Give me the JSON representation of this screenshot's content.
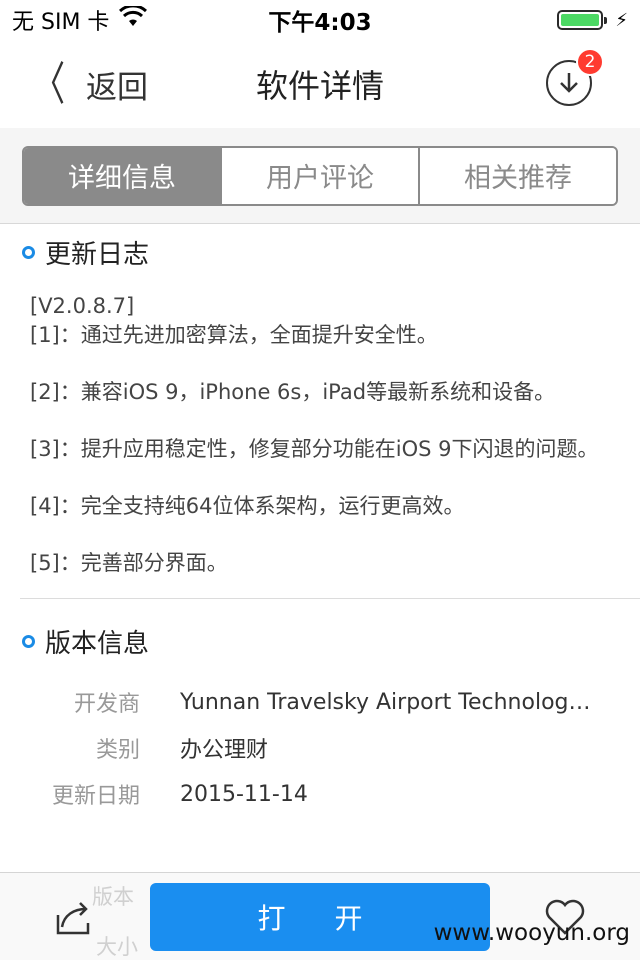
{
  "statusbar": {
    "carrier": "无 SIM 卡",
    "time": "下午4:03"
  },
  "navbar": {
    "back_label": "返回",
    "title": "软件详情",
    "download_badge": "2"
  },
  "tabs": [
    {
      "label": "详细信息",
      "active": true
    },
    {
      "label": "用户评论",
      "active": false
    },
    {
      "label": "相关推荐",
      "active": false
    }
  ],
  "changelog": {
    "title": "更新日志",
    "version": "[V2.0.8.7]",
    "items": [
      "[1]：通过先进加密算法，全面提升安全性。",
      "[2]：兼容iOS 9，iPhone 6s，iPad等最新系统和设备。",
      "[3]：提升应用稳定性，修复部分功能在iOS 9下闪退的问题。",
      "[4]：完全支持纯64位体系架构，运行更高效。",
      "[5]：完善部分界面。"
    ]
  },
  "version_info": {
    "title": "版本信息",
    "rows": [
      {
        "key": "开发商",
        "value": "Yunnan Travelsky Airport Technology C..."
      },
      {
        "key": "类别",
        "value": "办公理财"
      },
      {
        "key": "更新日期",
        "value": "2015-11-14"
      }
    ],
    "faded_rows": [
      "版本",
      "大小"
    ]
  },
  "bottombar": {
    "open_label": "打 开"
  },
  "watermark": "www.wooyun.org"
}
